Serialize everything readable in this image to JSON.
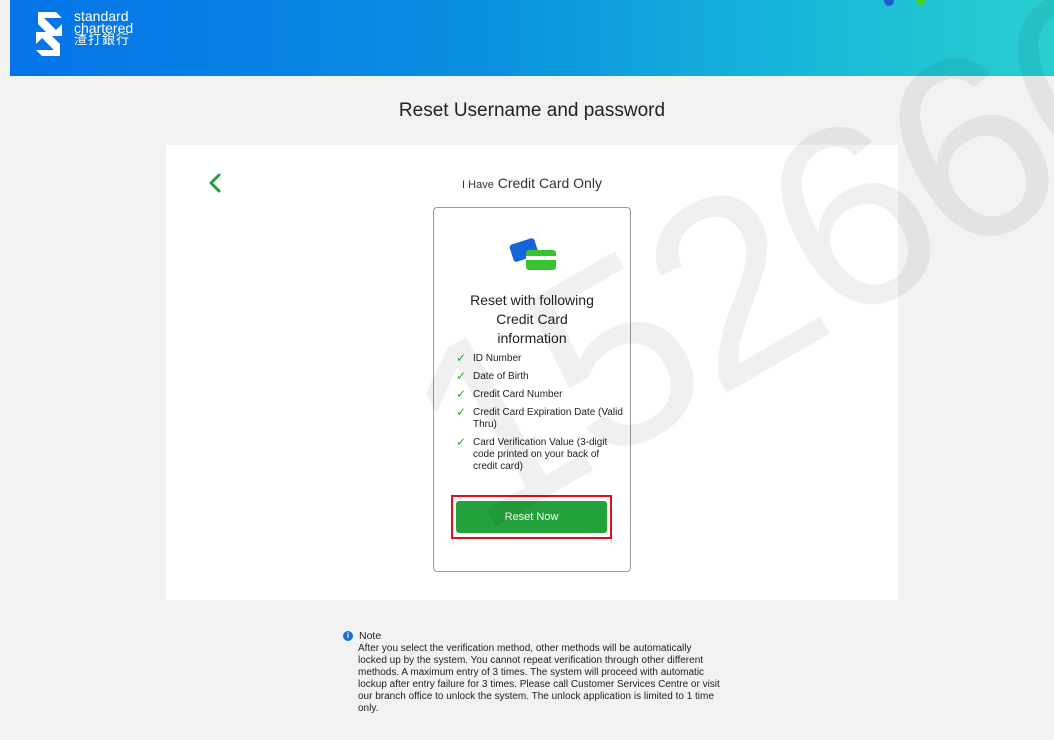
{
  "brand": {
    "name_line1": "standard",
    "name_line2": "chartered",
    "name_cn": "渣打銀行",
    "header_gradient": [
      "#0473e8",
      "#29cfd0"
    ]
  },
  "page": {
    "title": "Reset Username and password"
  },
  "method": {
    "subtitle_small": "I Have",
    "subtitle": "Credit Card Only",
    "back_icon": "chevron-left-icon",
    "card_icon": "credit-cards-icon",
    "heading": "Reset with following Credit Card information",
    "requirements": [
      "ID Number",
      "Date of Birth",
      "Credit Card Number",
      "Credit Card Expiration Date (Valid Thru)",
      "Card Verification Value (3-digit code printed on your back of credit card)"
    ],
    "check_icon": "check-icon",
    "button_label": "Reset Now",
    "button_color": "#23a23c",
    "highlight_color": "#e10d1a"
  },
  "watermark": "1526660",
  "note": {
    "icon": "info-icon",
    "title": "Note",
    "body": "After you select the verification method, other methods will be automatically locked up by the system. You cannot repeat verification through other different methods. A maximum entry of 3 times. The system will proceed with automatic lockup after entry failure for 3 times. Please call Customer Services Centre or visit our branch office to unlock the system. The unlock application is limited to 1 time only."
  }
}
